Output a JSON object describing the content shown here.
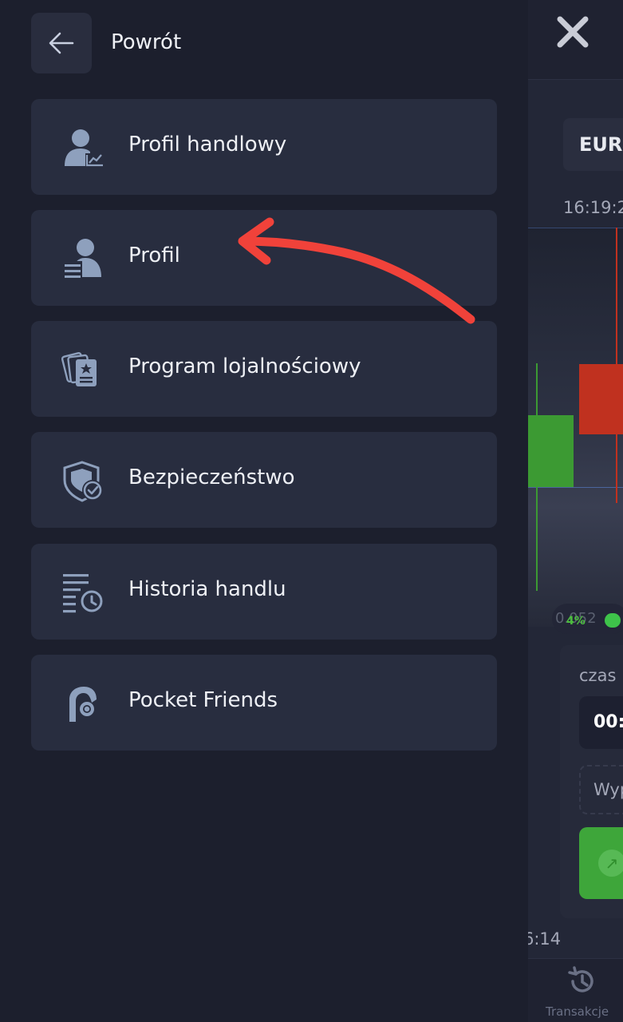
{
  "drawer": {
    "back_label": "Powrót",
    "menu": [
      {
        "label": "Profil handlowy",
        "icon": "trading-profile-icon"
      },
      {
        "label": "Profil",
        "icon": "profile-icon"
      },
      {
        "label": "Program lojalnościowy",
        "icon": "loyalty-cards-icon"
      },
      {
        "label": "Bezpieczeństwo",
        "icon": "shield-check-icon"
      },
      {
        "label": "Historia handlu",
        "icon": "trade-history-icon"
      },
      {
        "label": "Pocket Friends",
        "icon": "pocket-friends-icon"
      }
    ]
  },
  "background": {
    "pair_label": "EUR",
    "time_label": "16:19:2",
    "price_partial": "0.052",
    "percent": "4%",
    "panel_label": "czas",
    "panel_time": "00:",
    "panel_wyp": "Wyp",
    "time_bottom": "6:14",
    "nav_transactions": "Transakcje"
  },
  "colors": {
    "drawer_bg": "#1c1f2d",
    "item_bg": "#282d3f",
    "text": "#eef0f5",
    "icon": "#8ea0bd",
    "candle_up": "#3c9a33",
    "candle_down": "#c0311f",
    "annotation": "#f0423a"
  }
}
